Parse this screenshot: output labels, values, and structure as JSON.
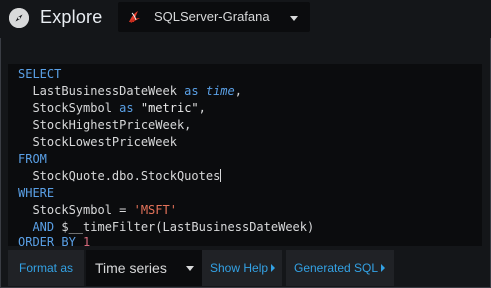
{
  "header": {
    "title": "Explore",
    "datasource": {
      "label": "SQLServer-Grafana",
      "icon": "sqlserver-icon"
    }
  },
  "editor": {
    "lines": {
      "l1": {
        "kw": "SELECT"
      },
      "l2": {
        "id": "LastBusinessDateWeek ",
        "kw": "as ",
        "it": "time",
        "tail": ","
      },
      "l3": {
        "id": "StockSymbol ",
        "kw": "as ",
        "str": "\"metric\"",
        "tail": ","
      },
      "l4": {
        "id": "StockHighestPriceWeek,"
      },
      "l5": {
        "id": "StockLowestPriceWeek"
      },
      "l6": {
        "kw": "FROM"
      },
      "l7": {
        "id": "StockQuote.dbo.StockQuotes"
      },
      "l8": {
        "kw": "WHERE"
      },
      "l9": {
        "id": "StockSymbol = ",
        "sq": "'MSFT'"
      },
      "l10": {
        "kw": "AND ",
        "id": "$__timeFilter(LastBusinessDateWeek)"
      },
      "l11": {
        "kw": "ORDER BY ",
        "num": "1"
      }
    }
  },
  "toolbar": {
    "format_label": "Format as",
    "format_value": "Time series",
    "show_help": "Show Help",
    "generated_sql": "Generated SQL"
  },
  "colors": {
    "keyword": "#5aa0e6",
    "string": "#e5735a",
    "number": "#d66a7c",
    "link": "#33a2e5",
    "background": "#141619",
    "editor_bg": "#0b0c0e"
  }
}
